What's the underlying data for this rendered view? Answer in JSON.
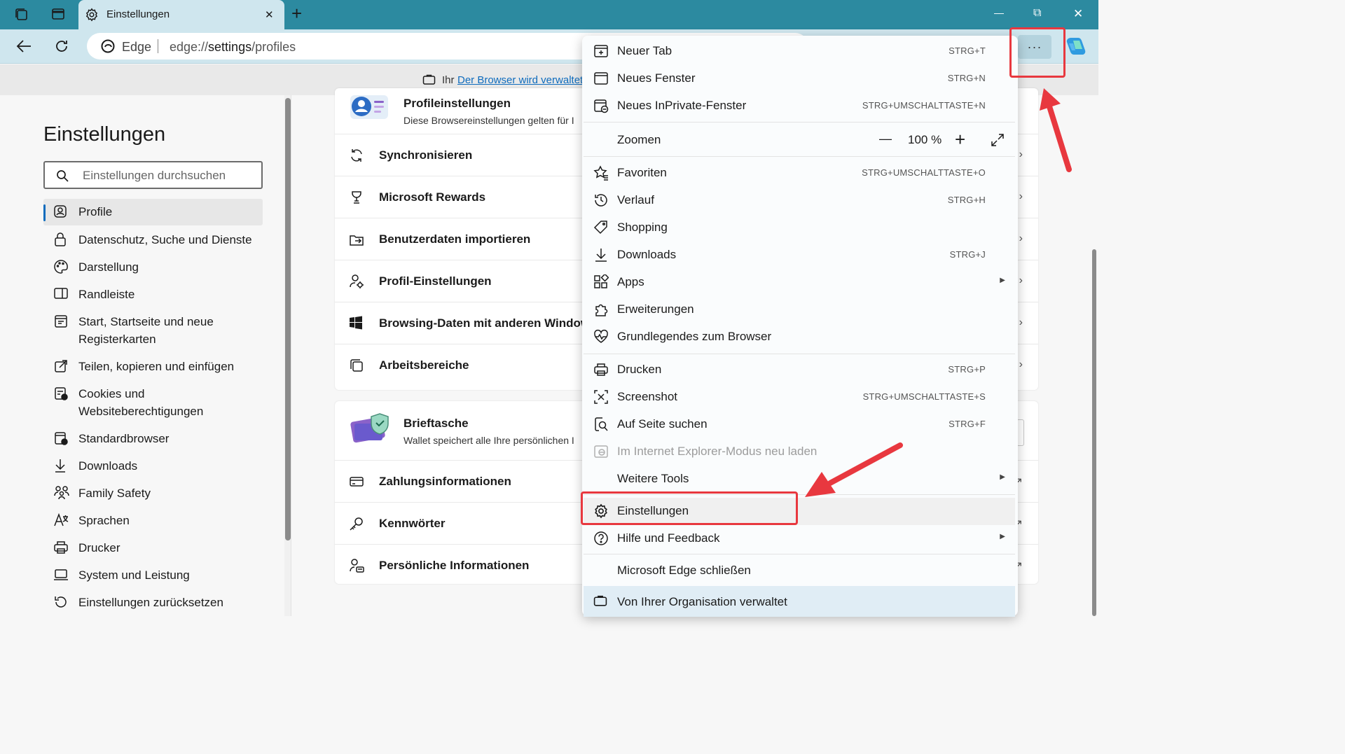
{
  "browser": {
    "tab_title": "Einstellungen",
    "tab_close": "✕",
    "new_tab_glyph": "+",
    "window_controls": {
      "minimize": "—",
      "restore": "⧉",
      "close": "✕"
    },
    "address": {
      "site": "Edge",
      "url_prefix": "edge://",
      "url_path": "settings",
      "url_suffix": "/profiles"
    },
    "more_button": "···",
    "managed_info": {
      "text": "Ihr",
      "link": "Der Browser wird verwaltet"
    }
  },
  "sidebar": {
    "title": "Einstellungen",
    "search_placeholder": "Einstellungen durchsuchen",
    "items": [
      {
        "label": "Profile",
        "icon": "profile-icon",
        "active": true
      },
      {
        "label": "Datenschutz, Suche und Dienste",
        "icon": "lock-icon"
      },
      {
        "label": "Darstellung",
        "icon": "palette-icon"
      },
      {
        "label": "Randleiste",
        "icon": "sidebar-icon"
      },
      {
        "label": "Start, Startseite und neue",
        "label2": "Registerkarten",
        "icon": "home-icon"
      },
      {
        "label": "Teilen, kopieren und einfügen",
        "icon": "share-icon"
      },
      {
        "label": "Cookies und",
        "label2": "Websiteberechtigungen",
        "icon": "cookie-icon"
      },
      {
        "label": "Standardbrowser",
        "icon": "browser-icon"
      },
      {
        "label": "Downloads",
        "icon": "download-icon"
      },
      {
        "label": "Family Safety",
        "icon": "family-icon"
      },
      {
        "label": "Sprachen",
        "icon": "language-icon"
      },
      {
        "label": "Drucker",
        "icon": "printer-icon"
      },
      {
        "label": "System und Leistung",
        "icon": "laptop-icon"
      },
      {
        "label": "Einstellungen zurücksetzen",
        "icon": "reset-icon"
      }
    ]
  },
  "main": {
    "profile_card": {
      "title": "Profileinstellungen",
      "subtitle": "Diese Browsereinstellungen gelten für I",
      "rows": [
        "Synchronisieren",
        "Microsoft Rewards",
        "Benutzerdaten importieren",
        "Profil-Einstellungen",
        "Browsing-Daten mit anderen Window",
        "Arbeitsbereiche"
      ]
    },
    "wallet_card": {
      "title": "Brieftasche",
      "subtitle": "Wallet speichert alle Ihre persönlichen I",
      "rows": [
        "Zahlungsinformationen",
        "Kennwörter",
        "Persönliche Informationen"
      ]
    },
    "chevron": "›",
    "external": "↗"
  },
  "menu": {
    "items": [
      {
        "label": "Neuer Tab",
        "shortcut": "STRG+T",
        "icon": "new-tab-icon"
      },
      {
        "label": "Neues Fenster",
        "shortcut": "STRG+N",
        "icon": "window-icon"
      },
      {
        "label": "Neues InPrivate-Fenster",
        "shortcut": "STRG+UMSCHALTTASTE+N",
        "icon": "inprivate-icon"
      },
      {
        "label": "Zoomen",
        "zoom": "100 %",
        "minus": "—",
        "plus": "+"
      },
      {
        "label": "Favoriten",
        "shortcut": "STRG+UMSCHALTTASTE+O",
        "icon": "favorites-icon"
      },
      {
        "label": "Verlauf",
        "shortcut": "STRG+H",
        "icon": "history-icon"
      },
      {
        "label": "Shopping",
        "icon": "tag-icon"
      },
      {
        "label": "Downloads",
        "shortcut": "STRG+J",
        "icon": "download-icon"
      },
      {
        "label": "Apps",
        "icon": "apps-icon",
        "submenu": "▶"
      },
      {
        "label": "Erweiterungen",
        "icon": "puzzle-icon"
      },
      {
        "label": "Grundlegendes zum Browser",
        "icon": "heart-icon"
      },
      {
        "label": "Drucken",
        "shortcut": "STRG+P",
        "icon": "print-icon"
      },
      {
        "label": "Screenshot",
        "shortcut": "STRG+UMSCHALTTASTE+S",
        "icon": "screenshot-icon"
      },
      {
        "label": "Auf Seite suchen",
        "shortcut": "STRG+F",
        "icon": "find-icon"
      },
      {
        "label": "Im Internet Explorer-Modus neu laden",
        "icon": "ie-icon",
        "disabled": true
      },
      {
        "label": "Weitere Tools",
        "submenu": "▶"
      },
      {
        "label": "Einstellungen",
        "icon": "settings-icon"
      },
      {
        "label": "Hilfe und Feedback",
        "icon": "help-icon",
        "submenu": "▶"
      },
      {
        "label": "Microsoft Edge schließen"
      },
      {
        "label": "Von Ihrer Organisation verwaltet",
        "icon": "briefcase-icon"
      }
    ]
  },
  "annotations": {
    "color": "#e8383f"
  }
}
